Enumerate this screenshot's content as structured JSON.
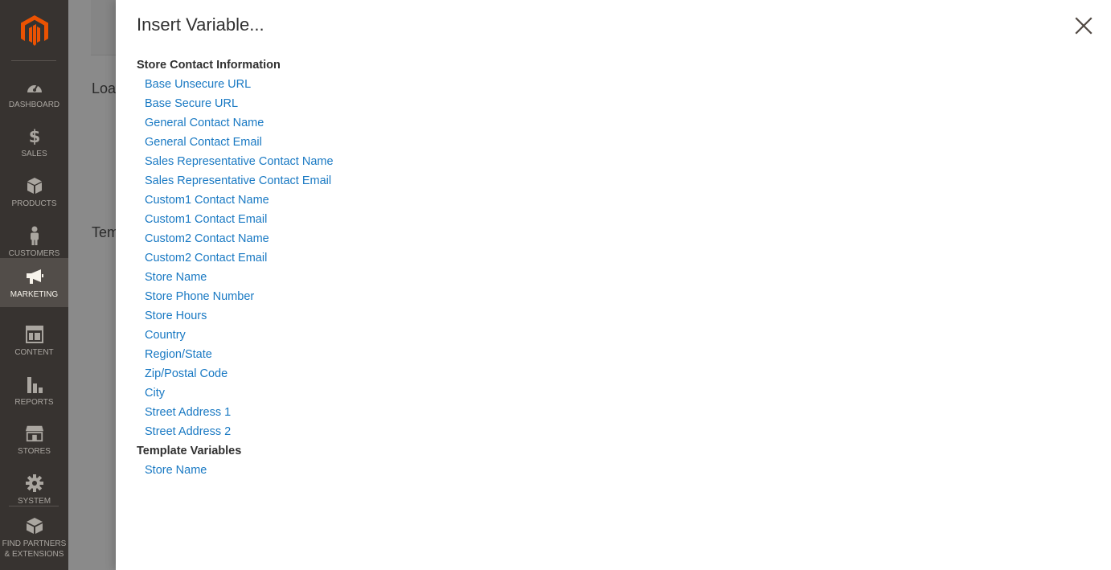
{
  "sidebar": {
    "logo_icon": "magento-logo-icon",
    "accent": "#eb5202",
    "items": [
      {
        "id": "dashboard",
        "label": "DASHBOARD",
        "icon": "dashboard-icon"
      },
      {
        "id": "sales",
        "label": "SALES",
        "icon": "dollar-icon"
      },
      {
        "id": "products",
        "label": "PRODUCTS",
        "icon": "box-icon"
      },
      {
        "id": "customers",
        "label": "CUSTOMERS",
        "icon": "person-icon"
      },
      {
        "id": "marketing",
        "label": "MARKETING",
        "icon": "megaphone-icon",
        "active": true
      },
      {
        "id": "content",
        "label": "CONTENT",
        "icon": "layout-icon"
      },
      {
        "id": "reports",
        "label": "REPORTS",
        "icon": "bar-chart-icon"
      },
      {
        "id": "stores",
        "label": "STORES",
        "icon": "storefront-icon"
      },
      {
        "id": "system",
        "label": "SYSTEM",
        "icon": "gear-icon"
      },
      {
        "id": "partners",
        "label": "FIND PARTNERS & EXTENSIONS",
        "icon": "cube-icon"
      }
    ]
  },
  "backdrop": {
    "heading_1": "Loa",
    "heading_2": "Tem"
  },
  "modal": {
    "title": "Insert Variable...",
    "close_icon": "close-icon",
    "link_color": "#1979c3",
    "groups": [
      {
        "title": "Store Contact Information",
        "items": [
          "Base Unsecure URL",
          "Base Secure URL",
          "General Contact Name",
          "General Contact Email",
          "Sales Representative Contact Name",
          "Sales Representative Contact Email",
          "Custom1 Contact Name",
          "Custom1 Contact Email",
          "Custom2 Contact Name",
          "Custom2 Contact Email",
          "Store Name",
          "Store Phone Number",
          "Store Hours",
          "Country",
          "Region/State",
          "Zip/Postal Code",
          "City",
          "Street Address 1",
          "Street Address 2"
        ]
      },
      {
        "title": "Template Variables",
        "items": [
          "Store Name"
        ]
      }
    ]
  }
}
